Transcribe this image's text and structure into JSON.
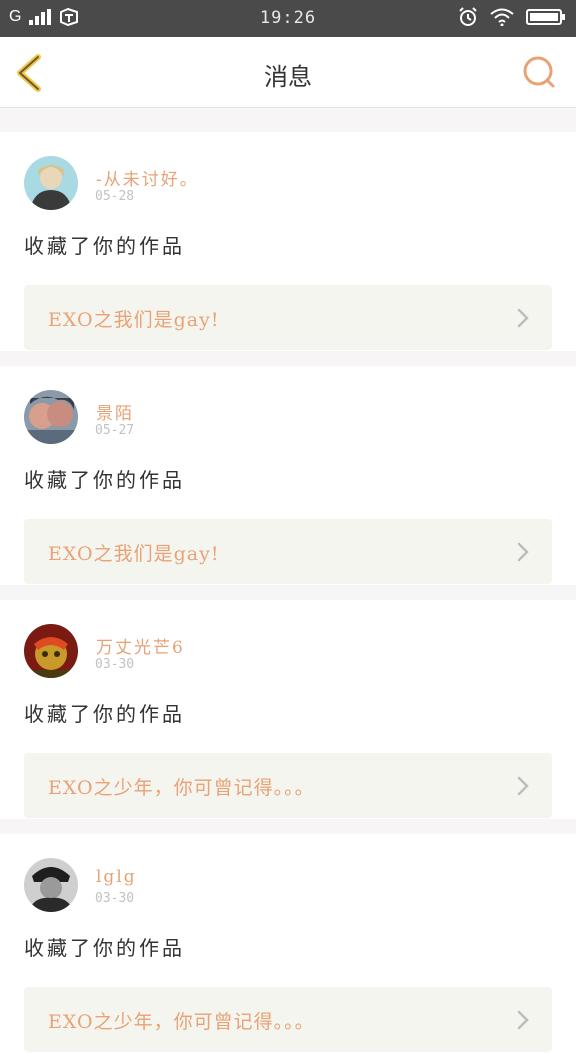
{
  "status_bar": {
    "carrier": "G",
    "time": "19:26"
  },
  "header": {
    "title": "消息",
    "back_icon": "chevron-left-icon",
    "search_icon": "search-icon"
  },
  "colors": {
    "accent": "#e8a276",
    "back_icon": "#f0c94c",
    "card_bg": "#f5f5ef"
  },
  "messages": [
    {
      "username": "-从未讨好。",
      "date": "05-28",
      "action": "收藏了你的作品",
      "work_title": "EXO之我们是gay!"
    },
    {
      "username": "景陌",
      "date": "05-27",
      "action": "收藏了你的作品",
      "work_title": "EXO之我们是gay!"
    },
    {
      "username": "万丈光芒6",
      "date": "03-30",
      "action": "收藏了你的作品",
      "work_title": "EXO之少年，你可曾记得。。。"
    },
    {
      "username": "lglg",
      "date": "03-30",
      "action": "收藏了你的作品",
      "work_title": "EXO之少年，你可曾记得。。。"
    }
  ]
}
